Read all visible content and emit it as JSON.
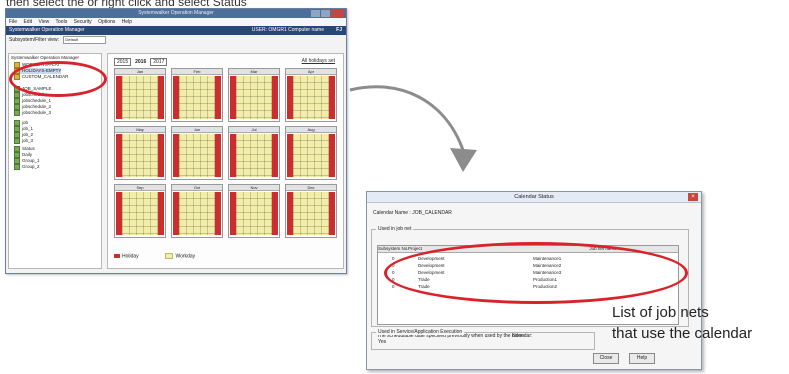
{
  "top_caption": "then select the or right click and select Status",
  "main_window": {
    "title": "Systemwalker Operation Manager",
    "menu": [
      "File",
      "Edit",
      "View",
      "Tools",
      "Security",
      "Options",
      "Help"
    ],
    "app_header": "Systemwalker Operation Manager",
    "user": "USER: OMGR1 Computer name",
    "logo": "FJ",
    "filter_label": "Subsystem/Filter view:",
    "filter_value": "Default",
    "tree_root": "Systemwalker Operation Manager",
    "tree_items": [
      "WORKDAYS-FLAT",
      "HOLIDAYS-EMPTY",
      "CUSTOM_CALENDAR",
      "JOB_SAMPLE",
      "jobschedule",
      "jobschedule_1",
      "jobschedule_2",
      "jobschedule_3",
      "job",
      "job_1",
      "job_2",
      "job_3",
      "Status",
      "Daily",
      "Group_1",
      "Group_2"
    ],
    "year_prev": "2015",
    "year_current": "2016",
    "year_next": "2017",
    "link_right": "All holidays set",
    "month_names": [
      "Jan",
      "Feb",
      "Mar",
      "Apr",
      "May",
      "Jun",
      "Jul",
      "Aug",
      "Sep",
      "Oct",
      "Nov",
      "Dec"
    ],
    "legend_holiday": "Holiday",
    "legend_workday": "Workday"
  },
  "dialog": {
    "title": "Calendar Status",
    "calendar_name_label": "Calendar Name :",
    "calendar_name_value": "JOB_CALENDAR",
    "group_used": "Used in job net",
    "col_subsystem": "Subsystem No.",
    "col_project": "Project",
    "col_jobnet": "Job net name",
    "rows": [
      {
        "subsystem": "0",
        "project": "Development",
        "jobnet": "Maintenance1"
      },
      {
        "subsystem": "0",
        "project": "Development",
        "jobnet": "Maintenance2"
      },
      {
        "subsystem": "0",
        "project": "Development",
        "jobnet": "Maintenance3"
      },
      {
        "subsystem": "0",
        "project": "Trade",
        "jobnet": "Production1"
      },
      {
        "subsystem": "0",
        "project": "Trade",
        "jobnet": "Production2"
      }
    ],
    "schedulable_note": "The schedulable date specified previously when used by the calendar:",
    "schedulable_value": "None",
    "group_service": "Used in Service/Application Execution",
    "service_value": "Yes",
    "ok_label": "Close",
    "help_label": "Help"
  },
  "caption_lines": [
    "List of job nets",
    "that use the calendar"
  ],
  "colors": {
    "highlight_ring": "#d9232b",
    "holiday": "#cc2d2d",
    "workday": "#f2eeaa",
    "header": "#27467a"
  }
}
